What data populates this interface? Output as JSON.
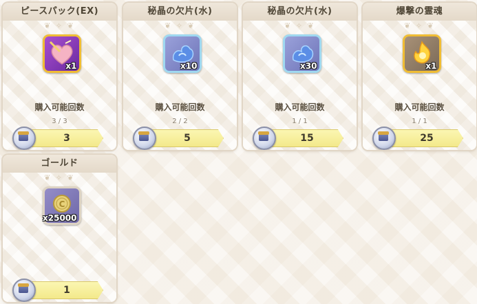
{
  "label_buyable": "購入可能回数",
  "cards": [
    {
      "title": "ピースパック(EX)",
      "qty": "x1",
      "count": "3 / 3",
      "price": "3"
    },
    {
      "title": "秘晶の欠片(水)",
      "qty": "x10",
      "count": "2 / 2",
      "price": "5"
    },
    {
      "title": "秘晶の欠片(水)",
      "qty": "x30",
      "count": "1 / 1",
      "price": "15"
    },
    {
      "title": "爆撃の霊魂",
      "qty": "x1",
      "count": "1 / 1",
      "price": "25"
    },
    {
      "title": "ゴールド",
      "qty": "x25000",
      "count": "",
      "price": "1"
    }
  ],
  "icons": [
    "heart-piece-pack-icon",
    "water-crystal-shard-icon",
    "water-crystal-shard-icon",
    "explosion-spirit-icon",
    "gold-coin-icon"
  ],
  "colors": {
    "price_bar": "#f3e98a",
    "gold_frame": "#f0bd34",
    "blue_frame": "#9fd8f0"
  }
}
